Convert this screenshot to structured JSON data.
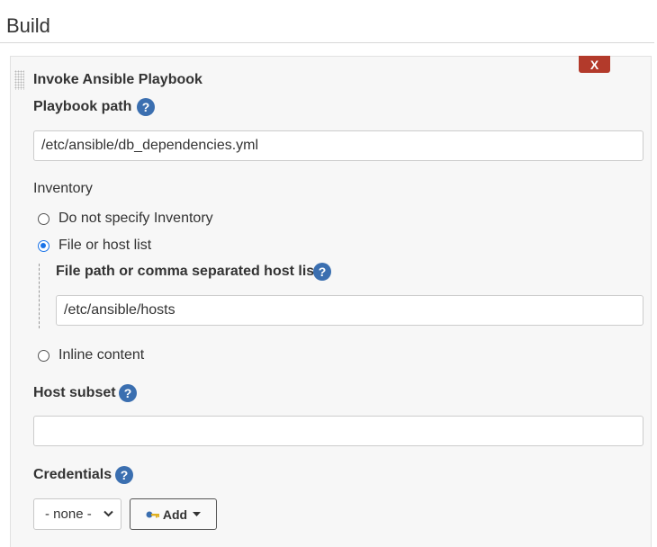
{
  "section": {
    "title": "Build"
  },
  "step": {
    "title": "Invoke Ansible Playbook",
    "delete_label": "X"
  },
  "playbook": {
    "label": "Playbook path",
    "value": "/etc/ansible/db_dependencies.yml"
  },
  "inventory": {
    "label": "Inventory",
    "options": [
      {
        "label": "Do not specify Inventory",
        "checked": false
      },
      {
        "label": "File or host list",
        "checked": true
      },
      {
        "label": "Inline content",
        "checked": false
      }
    ],
    "file_path": {
      "label": "File path or comma separated host list",
      "value": "/etc/ansible/hosts"
    }
  },
  "host_subset": {
    "label": "Host subset",
    "value": ""
  },
  "credentials": {
    "label": "Credentials",
    "selected": "- none -",
    "add_label": "Add"
  },
  "help_glyph": "?",
  "colors": {
    "help": "#3b6fb0",
    "delete": "#b33a2b",
    "radio_checked": "#1a73e8"
  },
  "icons": [
    "drag-handle",
    "help-icon",
    "key-icon",
    "chevron-down-icon",
    "caret-down-icon"
  ]
}
